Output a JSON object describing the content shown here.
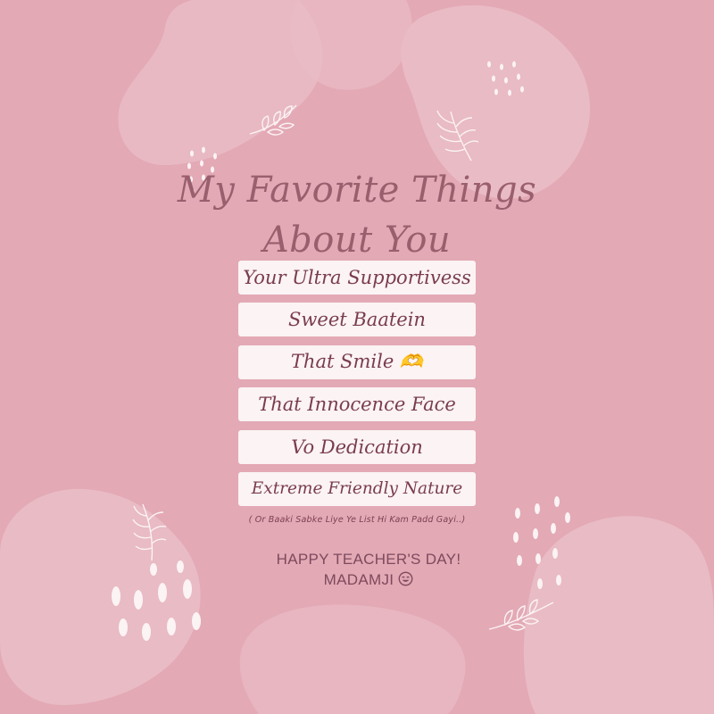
{
  "title": {
    "line1": "My Favorite Things",
    "line2": "About You"
  },
  "items": [
    "Your Ultra Supportivess",
    "Sweet Baatein",
    "That Smile 🫶",
    "That Innocence Face",
    "Vo Dedication",
    "Extreme Friendly Nature"
  ],
  "note": "( Or Baaki Sabke Liye Ye List Hi Kam Padd Gayi..)",
  "greeting": {
    "line1": "HAPPY TEACHER'S DAY!",
    "line2": "MADAMJI"
  },
  "icons": {
    "greeting_emoji": "smiling-face-icon",
    "decorations": [
      "leaf-sprig-icon",
      "fern-icon",
      "dots-pattern-icon"
    ]
  },
  "colors": {
    "background": "#e3a9b5",
    "blob": "#e9bcc5",
    "card": "#fbf3f4",
    "text": "#7a3c4f",
    "title": "#9a5f6d"
  }
}
